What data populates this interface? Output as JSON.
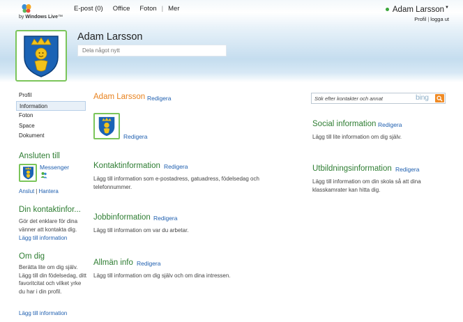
{
  "header": {
    "logo_by": "by",
    "logo_brand": "Windows Live",
    "logo_tm": "™",
    "nav": [
      "E-post (0)",
      "Office",
      "Foton",
      "Mer"
    ],
    "user_name": "Adam Larsson",
    "profile_link": "Profil",
    "signout_link": "logga ut"
  },
  "profile": {
    "name": "Adam Larsson",
    "status_placeholder": "Dela något nytt"
  },
  "sidebar": {
    "items": [
      "Profil",
      "Information",
      "Foton",
      "Space",
      "Dokument"
    ],
    "active_index": 1,
    "connected": {
      "heading": "Ansluten till",
      "service": "Messenger",
      "connect": "Anslut",
      "manage": "Hantera"
    },
    "contact": {
      "heading": "Din kontaktinfor...",
      "text": "Gör det enklare för dina vänner att kontakta dig.",
      "link": "Lägg till information"
    },
    "about": {
      "heading": "Om dig",
      "text": "Berätta lite om dig själv. Lägg till din födelsedag, ditt favoritcitat och vilket yrke du har i din profil.",
      "link": "Lägg till information"
    }
  },
  "main": {
    "name": "Adam Larsson",
    "edit": "Redigera",
    "picture_edit": "Redigera",
    "sections": [
      {
        "title": "Kontaktinformation",
        "edit": "Redigera",
        "text": "Lägg till information som e-postadress, gatuadress, födelsedag och telefonnummer."
      },
      {
        "title": "Jobbinformation",
        "edit": "Redigera",
        "text": "Lägg till information om var du arbetar."
      },
      {
        "title": "Allmän info",
        "edit": "Redigera",
        "text": "Lägg till information om dig själv och om dina intressen."
      },
      {
        "title": "Social information",
        "edit": "Redigera",
        "text": "Lägg till lite information om dig själv."
      },
      {
        "title": "Utbildningsinformation",
        "edit": "Redigera",
        "text": "Lägg till information om din skola så att dina klasskamrater kan hitta dig."
      }
    ]
  },
  "search": {
    "placeholder": "Sök efter kontakter och annat",
    "brand": "bing"
  },
  "colors": {
    "accent_green": "#2e7d32",
    "link_blue": "#2060b0",
    "name_orange": "#e8821e",
    "search_orange": "#f08a24",
    "frame_green": "#7bc55a"
  },
  "icons": {
    "logo": "windows-live-butterfly-icon",
    "avatar": "coat-of-arms-icon",
    "search": "magnifier-icon",
    "messenger": "messenger-buddy-icon"
  }
}
